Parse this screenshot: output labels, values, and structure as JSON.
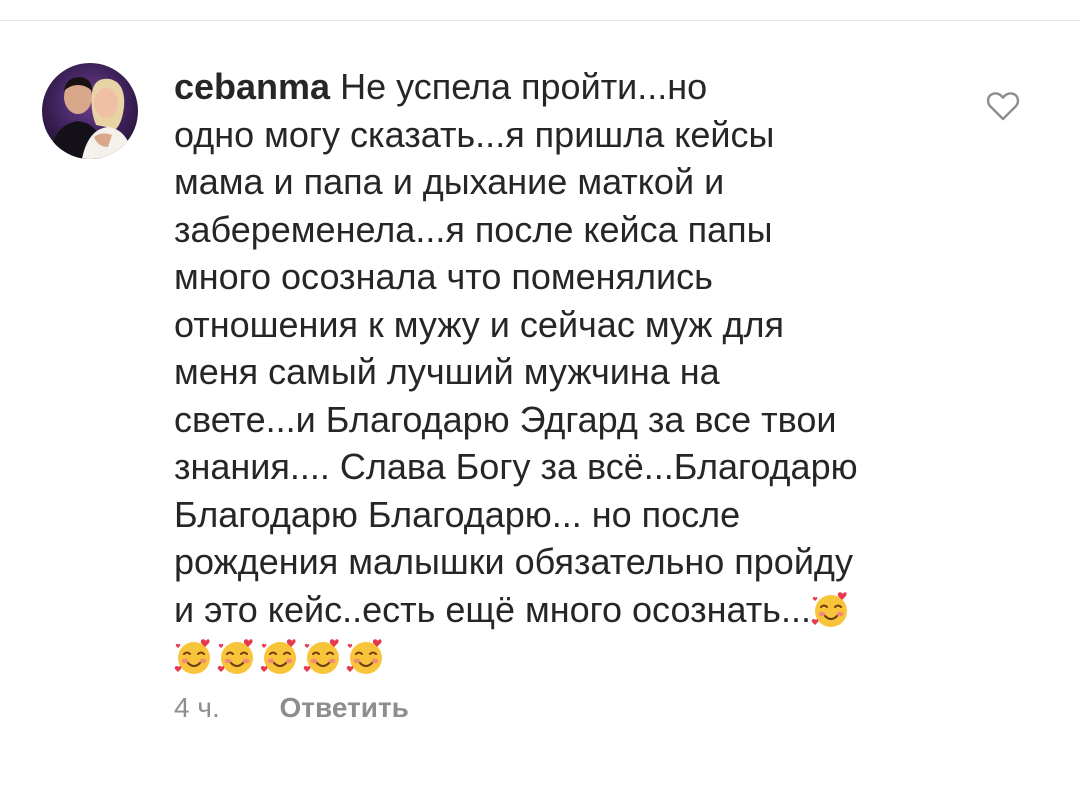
{
  "comment": {
    "username": "cebanma",
    "first_line": "Не успела пройти...но",
    "lines": [
      "одно могу сказать...я пришла кейсы",
      "мама и папа и дыхание маткой и",
      "забеременела...я после кейса папы",
      "много осознала что поменялись",
      "отношения к мужу и сейчас муж для",
      "меня самый лучший мужчина на",
      "свете...и Благодарю Эдгард за все твои",
      "знания.... Слава Богу за всё...Благодарю",
      "Благодарю Благодарю... но после",
      "рождения малышки обязательно пройду"
    ],
    "last_line": "и это кейс..есть ещё много осознать...",
    "emoji_name": "smiling-face-with-hearts-emoji",
    "timestamp": "4 ч.",
    "reply_label": "Ответить"
  },
  "icons": {
    "like": "heart-outline-icon",
    "avatar": "user-avatar-photo"
  },
  "colors": {
    "text": "#262626",
    "secondary": "#8e8e8e",
    "divider": "#e6e6e6",
    "icon": "#8e8e8e"
  }
}
